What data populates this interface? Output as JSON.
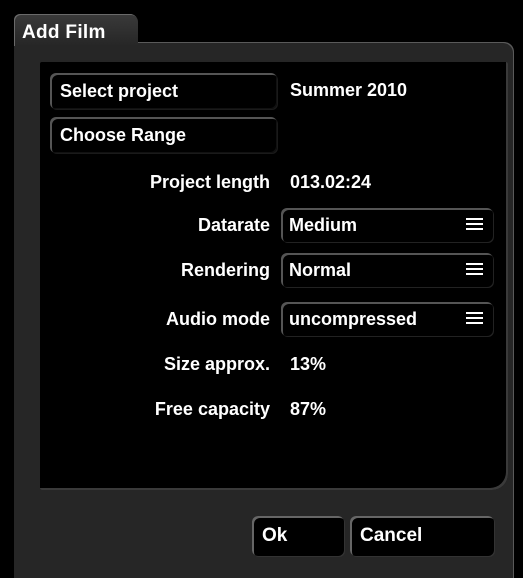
{
  "window": {
    "title": "Add Film"
  },
  "buttons": {
    "select_project": "Select project",
    "choose_range": "Choose Range",
    "ok": "Ok",
    "cancel": "Cancel"
  },
  "project": {
    "name": "Summer 2010"
  },
  "fields": {
    "project_length": {
      "label": "Project length",
      "value": "013.02:24"
    },
    "datarate": {
      "label": "Datarate",
      "value": "Medium"
    },
    "rendering": {
      "label": "Rendering",
      "value": "Normal"
    },
    "audio_mode": {
      "label": "Audio mode",
      "value": "uncompressed"
    },
    "size_approx": {
      "label": "Size approx.",
      "value": "13%"
    },
    "free_capacity": {
      "label": "Free capacity",
      "value": "87%"
    }
  },
  "icons": {
    "dropdown": "menu-icon"
  },
  "colors": {
    "background": "#000000",
    "frame": "#262626",
    "text": "#ffffff"
  }
}
